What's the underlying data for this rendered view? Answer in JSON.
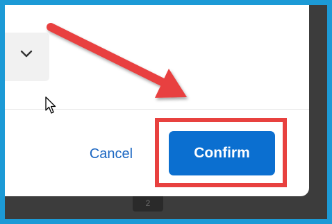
{
  "dialog": {
    "cancel_label": "Cancel",
    "confirm_label": "Confirm",
    "dropdown_icon": "chevron-down-icon"
  },
  "background_page": {
    "chip_text": "2"
  },
  "annotation": {
    "highlight_color": "#e8413f",
    "arrow_color": "#e8413f",
    "frame_color": "#1c9ad6"
  },
  "colors": {
    "primary": "#0b6fd0",
    "link": "#1a66c2"
  }
}
